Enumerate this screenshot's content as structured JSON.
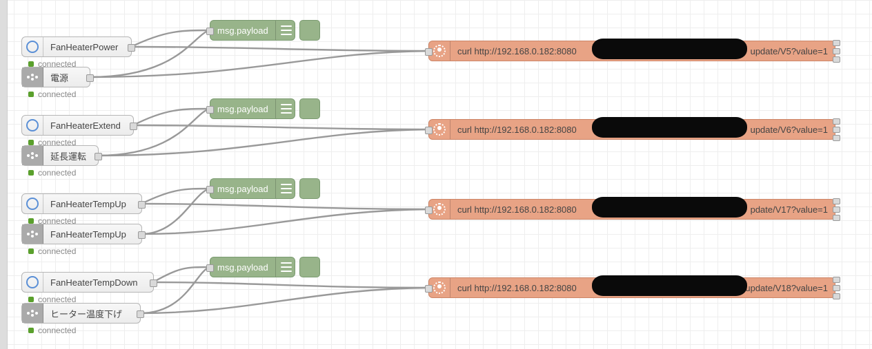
{
  "status_text": "connected",
  "colors": {
    "gray": "#ececec",
    "green": "#98b48a",
    "orange": "#e8a385",
    "wire": "#999999",
    "led": "#5aa02c"
  },
  "debug_nodes": [
    {
      "label": "msg.payload"
    },
    {
      "label": "msg.payload"
    },
    {
      "label": "msg.payload"
    },
    {
      "label": "msg.payload"
    }
  ],
  "groups": [
    {
      "input_a": {
        "label": "FanHeaterPower",
        "icon": "ring"
      },
      "input_b": {
        "label": "電源",
        "icon": "google"
      },
      "exec": {
        "label": "curl http://192.168.0.182:8080",
        "suffix": "update/V5?value=1"
      }
    },
    {
      "input_a": {
        "label": "FanHeaterExtend",
        "icon": "ring"
      },
      "input_b": {
        "label": "延長運転",
        "icon": "google"
      },
      "exec": {
        "label": "curl http://192.168.0.182:8080",
        "suffix": "update/V6?value=1"
      }
    },
    {
      "input_a": {
        "label": "FanHeaterTempUp",
        "icon": "ring"
      },
      "input_b": {
        "label": "FanHeaterTempUp",
        "icon": "google"
      },
      "exec": {
        "label": "curl http://192.168.0.182:8080",
        "suffix": "pdate/V17?value=1"
      }
    },
    {
      "input_a": {
        "label": "FanHeaterTempDown",
        "icon": "ring"
      },
      "input_b": {
        "label": "ヒーター温度下げ",
        "icon": "google"
      },
      "exec": {
        "label": "curl http://192.168.0.182:8080",
        "suffix": "update/V18?value=1"
      }
    }
  ]
}
